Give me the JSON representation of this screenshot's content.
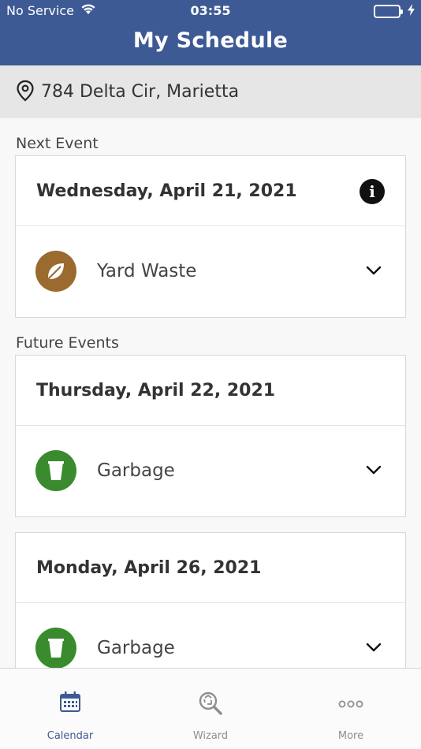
{
  "status_bar": {
    "carrier": "No Service",
    "time": "03:55"
  },
  "header": {
    "title": "My Schedule"
  },
  "address": {
    "text": "784 Delta Cir, Marietta",
    "icon": "map-pin-icon"
  },
  "sections": {
    "next_label": "Next Event",
    "future_label": "Future Events"
  },
  "events": [
    {
      "date": "Wednesday, April 21, 2021",
      "item": "Yard Waste",
      "icon": "leaf-icon",
      "color": "#9a6a2f"
    },
    {
      "date": "Thursday, April 22, 2021",
      "item": "Garbage",
      "icon": "trash-can-icon",
      "color": "#3a8a2e"
    },
    {
      "date": "Monday, April 26, 2021",
      "item": "Garbage",
      "icon": "trash-can-icon",
      "color": "#3a8a2e"
    }
  ],
  "tabs": [
    {
      "label": "Calendar",
      "icon": "calendar-icon",
      "active": true
    },
    {
      "label": "Wizard",
      "icon": "recycle-search-icon",
      "active": false
    },
    {
      "label": "More",
      "icon": "more-dots-icon",
      "active": false
    }
  ],
  "colors": {
    "header": "#3d5a94",
    "battery": "#4cd964",
    "tab_active": "#3d5a94",
    "tab_inactive": "#8e8e8e"
  }
}
